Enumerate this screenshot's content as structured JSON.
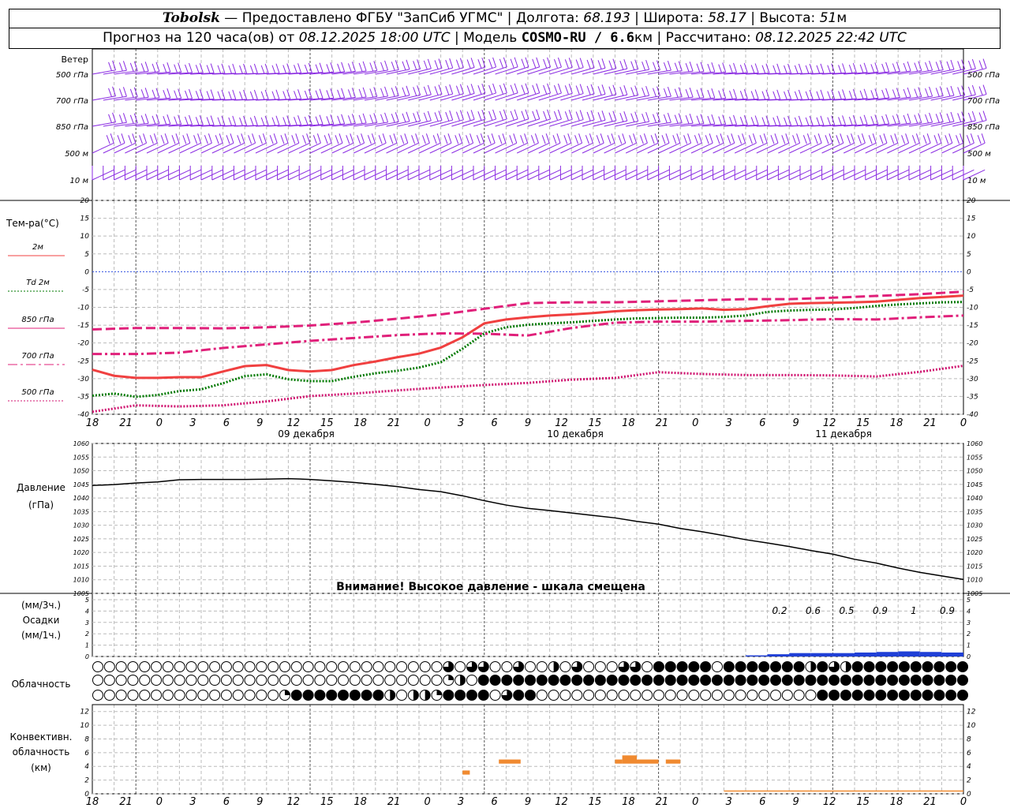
{
  "header": {
    "station": "Tobolsk",
    "dash": " — ",
    "provider": "Предоставлено ФГБУ \"ЗапСиб УГМС\"",
    "lon_label": "Долгота:",
    "lon_value": "68.193",
    "lat_label": "Широта:",
    "lat_value": "58.17",
    "alt_label": "Высота:",
    "alt_value": "51",
    "alt_unit": "м",
    "forecast_prefix": "Прогноз на 120 часа(ов) от",
    "forecast_start": "08.12.2025 18:00 UTC",
    "model_label": "Модель",
    "model_name": "COSMO-RU / 6.6",
    "model_unit": "км",
    "calc_label": "Рассчитано:",
    "calc_time": "08.12.2025 22:42 UTC",
    "sep": "|"
  },
  "wind_panel": {
    "title": "Ветер",
    "levels": [
      "500 гПа",
      "700 гПа",
      "850 гПа",
      "500 м",
      "10  м"
    ]
  },
  "temp_panel": {
    "title": "Тем-ра(°C)",
    "legend": [
      {
        "label": "2м",
        "color": "#f04040"
      },
      {
        "label": "Td  2м",
        "color": "#007a00"
      },
      {
        "label": "850 гПа",
        "color": "#e0207a"
      },
      {
        "label": "700 гПа",
        "color": "#e0207a"
      },
      {
        "label": "500 гПа",
        "color": "#d01470"
      }
    ]
  },
  "pressure_panel": {
    "title": "Давление",
    "unit": "(гПа)",
    "warning": "Внимание! Высокое давление - шкала смещена"
  },
  "precip_panel": {
    "unit3": "(мм/3ч.)",
    "title": "Осадки",
    "unit1": "(мм/1ч.)",
    "amounts_3h": [
      "0.2",
      "0.6",
      "0.5",
      "0.9",
      "1",
      "0.9"
    ]
  },
  "cloud_panel": {
    "title": "Облачность"
  },
  "conv_panel": {
    "title_1": "Конвективн.",
    "title_2": "облачность",
    "title_3": "(км)"
  },
  "time_axis": {
    "hour_labels": [
      "18",
      "21",
      "0",
      "3",
      "6",
      "9",
      "12",
      "15",
      "18",
      "21",
      "0",
      "3",
      "6",
      "9",
      "12",
      "15",
      "18",
      "21",
      "0",
      "3",
      "6",
      "9",
      "12",
      "15",
      "18",
      "21",
      "0"
    ],
    "day_labels": [
      "09 декабря",
      "10 декабря",
      "11 декабря"
    ]
  },
  "chart_data": [
    {
      "type": "line",
      "title": "Тем-ра(°C)",
      "x_unit": "hours from 08.12.2025 18:00 UTC",
      "ylim": [
        -40,
        20
      ],
      "yticks": [
        20,
        15,
        10,
        5,
        0,
        -5,
        -10,
        -15,
        -20,
        -25,
        -30,
        -35,
        -40
      ],
      "series": [
        {
          "name": "2м",
          "color": "#f04040",
          "style": "solid",
          "x": [
            0,
            3,
            6,
            9,
            12,
            15,
            18,
            21,
            24,
            27,
            30,
            33,
            36,
            39,
            42,
            45,
            48,
            51,
            54,
            57,
            60,
            63,
            66,
            69,
            72,
            75,
            78,
            81,
            84,
            87,
            90,
            93,
            96,
            99,
            102,
            105,
            108,
            111,
            114,
            117,
            120
          ],
          "y": [
            -27.5,
            -29.2,
            -29.8,
            -29.8,
            -29.6,
            -29.6,
            -28,
            -26.5,
            -26.2,
            -27.6,
            -28,
            -27.6,
            -26.2,
            -25.2,
            -24,
            -23,
            -21.3,
            -18.4,
            -14.5,
            -13.4,
            -12.8,
            -12.3,
            -12,
            -11.6,
            -11.1,
            -10.8,
            -10.6,
            -10.5,
            -10.3,
            -10.7,
            -10.5,
            -9.7,
            -9,
            -8.8,
            -8.7,
            -8.6,
            -8.4,
            -7.9,
            -7.4,
            -7.1,
            -6.7
          ]
        },
        {
          "name": "Td  2м",
          "color": "#007a00",
          "style": "dotted",
          "x": [
            0,
            3,
            6,
            9,
            12,
            15,
            18,
            21,
            24,
            27,
            30,
            33,
            36,
            39,
            42,
            45,
            48,
            51,
            54,
            57,
            60,
            63,
            66,
            69,
            72,
            75,
            78,
            81,
            84,
            87,
            90,
            93,
            96,
            99,
            102,
            105,
            108,
            111,
            114,
            117,
            120
          ],
          "y": [
            -34.8,
            -34.2,
            -35.1,
            -34.6,
            -33.5,
            -33,
            -31.3,
            -29.3,
            -28.8,
            -30.2,
            -30.7,
            -30.7,
            -29.5,
            -28.5,
            -27.8,
            -26.9,
            -25.4,
            -21.6,
            -17.3,
            -15.6,
            -14.9,
            -14.5,
            -14.2,
            -13.8,
            -13.4,
            -13.1,
            -13,
            -12.9,
            -12.9,
            -12.7,
            -12.3,
            -11.3,
            -10.9,
            -10.7,
            -10.6,
            -10.2,
            -9.6,
            -9.2,
            -8.9,
            -8.6,
            -8.5
          ]
        },
        {
          "name": "850 гПа",
          "color": "#e0207a",
          "style": "dashed",
          "x": [
            0,
            6,
            12,
            18,
            24,
            30,
            36,
            42,
            48,
            54,
            60,
            66,
            72,
            78,
            84,
            90,
            96,
            102,
            108,
            114,
            120
          ],
          "y": [
            -16.2,
            -15.8,
            -15.8,
            -15.9,
            -15.6,
            -15.1,
            -14.3,
            -13.2,
            -12,
            -10.4,
            -8.8,
            -8.6,
            -8.6,
            -8.3,
            -8,
            -7.7,
            -7.7,
            -7.3,
            -6.8,
            -6.3,
            -5.6
          ]
        },
        {
          "name": "700 гПа",
          "color": "#e0207a",
          "style": "dashdot",
          "x": [
            0,
            6,
            12,
            18,
            24,
            30,
            36,
            42,
            48,
            54,
            60,
            66,
            72,
            78,
            84,
            90,
            96,
            102,
            108,
            114,
            120
          ],
          "y": [
            -23.1,
            -23.1,
            -22.7,
            -21.4,
            -20.4,
            -19.4,
            -18.6,
            -17.8,
            -17.3,
            -17.4,
            -17.9,
            -15.8,
            -14.3,
            -14,
            -14,
            -13.8,
            -13.6,
            -13.3,
            -13.4,
            -12.8,
            -12.3
          ]
        },
        {
          "name": "500 гПа",
          "color": "#d01470",
          "style": "dotted",
          "x": [
            0,
            6,
            12,
            18,
            24,
            30,
            36,
            42,
            48,
            54,
            60,
            66,
            72,
            78,
            84,
            90,
            96,
            102,
            108,
            114,
            120
          ],
          "y": [
            -39.3,
            -37.5,
            -37.8,
            -37.5,
            -36.4,
            -34.9,
            -34.2,
            -33.3,
            -32.5,
            -31.8,
            -31.2,
            -30.3,
            -29.8,
            -28.2,
            -28.7,
            -29,
            -29,
            -29.1,
            -29.4,
            -28.1,
            -26.4
          ]
        }
      ]
    },
    {
      "type": "line",
      "title": "Давление",
      "ylabel": "(гПа)",
      "ylim": [
        1005,
        1060
      ],
      "yticks": [
        1060,
        1055,
        1050,
        1045,
        1040,
        1035,
        1030,
        1025,
        1020,
        1015,
        1010,
        1005
      ],
      "series": [
        {
          "name": "",
          "color": "#000000",
          "x": [
            0,
            3,
            6,
            9,
            12,
            15,
            18,
            21,
            24,
            27,
            30,
            33,
            36,
            39,
            42,
            45,
            48,
            51,
            54,
            57,
            60,
            63,
            66,
            69,
            72,
            75,
            78,
            81,
            84,
            87,
            90,
            93,
            96,
            99,
            102,
            105,
            108,
            111,
            114,
            117,
            120
          ],
          "y": [
            1044.6,
            1044.9,
            1045.5,
            1045.9,
            1046.7,
            1046.8,
            1046.8,
            1046.8,
            1046.9,
            1047.1,
            1046.8,
            1046.3,
            1045.7,
            1045,
            1044.2,
            1043.1,
            1042.3,
            1040.8,
            1039,
            1037.4,
            1036.2,
            1035.4,
            1034.5,
            1033.6,
            1032.7,
            1031.4,
            1030.4,
            1028.8,
            1027.6,
            1026.2,
            1024.7,
            1023.5,
            1022.2,
            1020.7,
            1019.4,
            1017.5,
            1016.1,
            1014.3,
            1012.7,
            1011.4,
            1010.1
          ]
        }
      ]
    },
    {
      "type": "bar",
      "title": "Осадки",
      "ylim": [
        0,
        5
      ],
      "yticks": [
        5,
        4,
        3,
        2,
        1,
        0
      ],
      "x": [
        93,
        96,
        99,
        102,
        105,
        108,
        111,
        114,
        117,
        120
      ],
      "values": [
        0.1,
        0.2,
        0.3,
        0.3,
        0.3,
        0.35,
        0.4,
        0.45,
        0.4,
        0.35
      ],
      "labels_3h": [
        "0.2",
        "0.6",
        "0.5",
        "0.9",
        "1",
        "0.9"
      ],
      "color": "#1f3fd6"
    },
    {
      "type": "bar",
      "title": "Конвективн. облачность (км)",
      "ylim": [
        0,
        13
      ],
      "yticks": [
        12,
        10,
        8,
        6,
        4,
        2,
        0
      ],
      "segments": [
        {
          "x0": 51,
          "x1": 52,
          "bottom": 2.8,
          "top": 3.4
        },
        {
          "x0": 56,
          "x1": 59,
          "bottom": 4.4,
          "top": 5.0
        },
        {
          "x0": 72,
          "x1": 73,
          "bottom": 4.4,
          "top": 5.0
        },
        {
          "x0": 73,
          "x1": 75,
          "bottom": 4.4,
          "top": 5.6
        },
        {
          "x0": 75,
          "x1": 78,
          "bottom": 4.4,
          "top": 5.0
        },
        {
          "x0": 79,
          "x1": 81,
          "bottom": 4.4,
          "top": 5.0
        }
      ],
      "base_line": {
        "x0": 87,
        "x1": 120,
        "value": 0.4
      },
      "color": "#f08a30"
    },
    {
      "type": "table",
      "title": "Облачность",
      "rows": [
        "upper",
        "middle",
        "lower"
      ],
      "codes": "0=clear,1=quarter,2=half,3=three-quarter,4=overcast",
      "upper": "000000000000000000000000000000303300300203000330444440444444424324444444444",
      "middle": "000000000000000000000000000000120444444444444444444444444444444444444444444",
      "lower": "000000000000000014444444420221444403440000000000000000000000004444444444444"
    }
  ]
}
